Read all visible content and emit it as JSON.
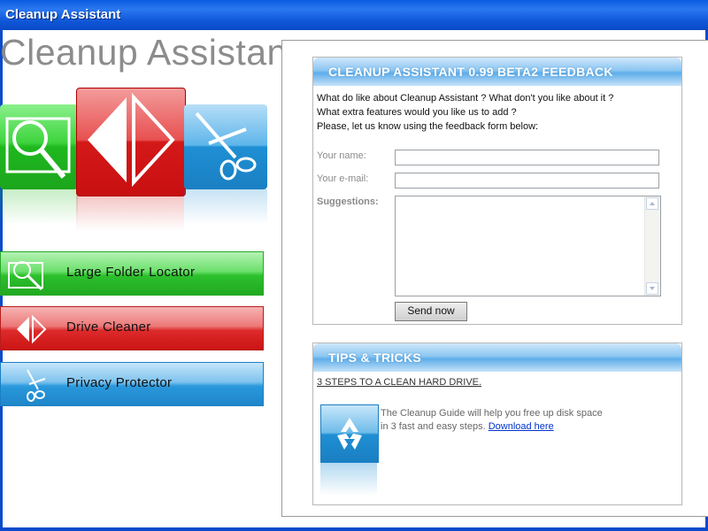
{
  "window": {
    "title": "Cleanup Assistant"
  },
  "app": {
    "title": "Cleanup Assistant"
  },
  "nav": {
    "items": [
      {
        "label": "Large Folder Locator",
        "icon": "magnifier-icon"
      },
      {
        "label": "Drive Cleaner",
        "icon": "diamond-icon"
      },
      {
        "label": "Privacy Protector",
        "icon": "scissors-icon"
      }
    ]
  },
  "feedback": {
    "heading": "CLEANUP ASSISTANT 0.99 BETA2 FEEDBACK",
    "intro_lines": [
      "What do like about Cleanup Assistant ? What don't you like about it ?",
      "What extra features would you like us to add ?",
      "Please, let us know using the feedback form below:"
    ],
    "name_label": "Your name:",
    "name_value": "",
    "email_label": "Your e-mail:",
    "email_value": "",
    "suggestions_label": "Suggestions:",
    "suggestions_value": "",
    "send_label": "Send now"
  },
  "tips": {
    "heading": "TIPS & TRICKS",
    "link": "3 STEPS TO A CLEAN HARD DRIVE.",
    "text_line1": "The Cleanup Guide will help you free up disk space",
    "text_line2": "in 3 fast and easy steps.",
    "download_link": "Download here"
  },
  "colors": {
    "titlebar": "#0a5be0",
    "green": "#2cc02c",
    "red": "#d41919",
    "blue": "#1f8fd4"
  }
}
